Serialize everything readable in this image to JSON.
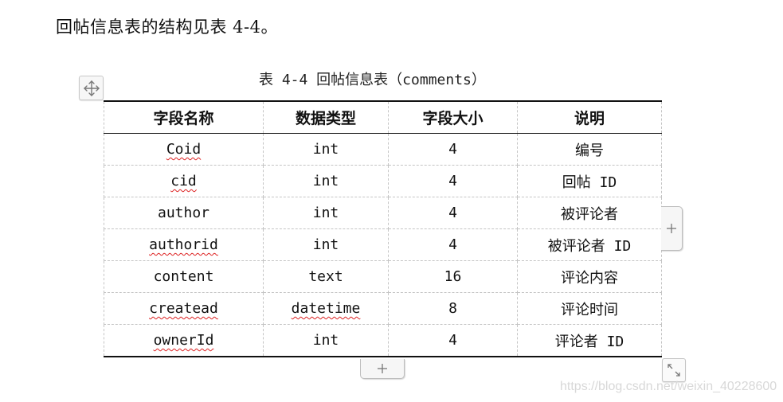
{
  "intro_text": "回帖信息表的结构见表 4-4。",
  "table": {
    "caption": "表 4-4 回帖信息表（comments）",
    "headers": [
      "字段名称",
      "数据类型",
      "字段大小",
      "说明"
    ],
    "rows": [
      {
        "name": "Coid",
        "type": "int",
        "size": "4",
        "desc": "编号"
      },
      {
        "name": "cid",
        "type": "int",
        "size": "4",
        "desc": "回帖 ID"
      },
      {
        "name": "author",
        "type": "int",
        "size": "4",
        "desc": "被评论者"
      },
      {
        "name": "authorid",
        "type": "int",
        "size": "4",
        "desc": "被评论者 ID"
      },
      {
        "name": "content",
        "type": "text",
        "size": "16",
        "desc": "评论内容"
      },
      {
        "name": "createad",
        "type": "datetime",
        "size": "8",
        "desc": "评论时间"
      },
      {
        "name": "ownerId",
        "type": "int",
        "size": "4",
        "desc": "评论者 ID"
      }
    ]
  },
  "icons": {
    "move": "move-arrows-icon",
    "add_column": "plus-icon",
    "add_row": "plus-icon",
    "resize": "resize-diagonal-icon"
  },
  "watermark": "https://blog.csdn.net/weixin_40228600"
}
